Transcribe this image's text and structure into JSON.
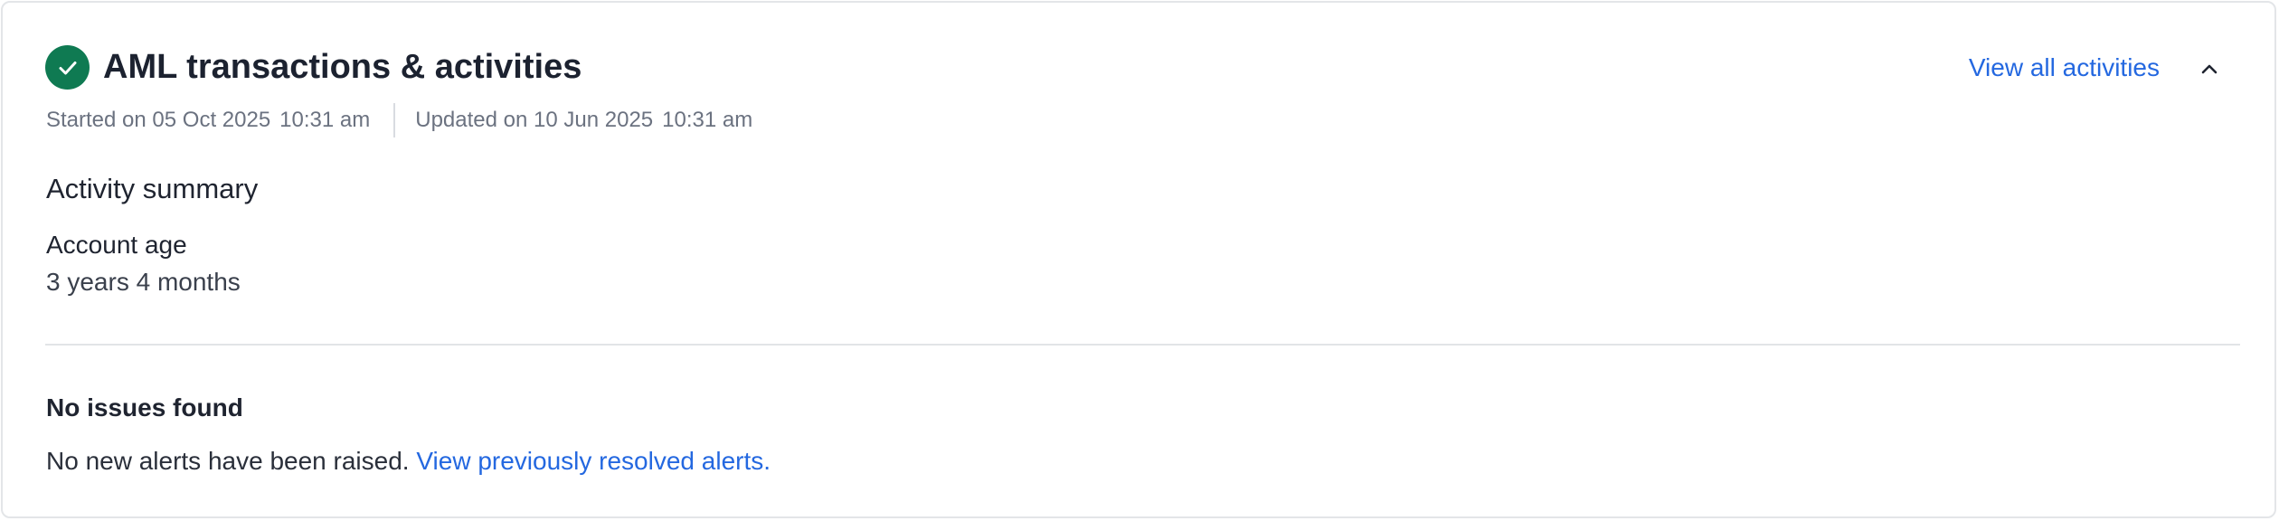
{
  "card": {
    "title": "AML transactions & activities",
    "status_icon": "check-circle-icon",
    "status_color": "#0f7a52",
    "view_all_label": "View all activities",
    "collapse_icon": "chevron-up-icon",
    "link_color": "#2468e0"
  },
  "meta": {
    "started_label": "Started on 05 Oct 2025",
    "started_time": "10:31 am",
    "updated_label": "Updated on 10 Jun 2025",
    "updated_time": "10:31 am"
  },
  "summary": {
    "heading": "Activity summary",
    "field_label": "Account age",
    "field_value": "3 years 4 months"
  },
  "issues": {
    "heading": "No issues found",
    "text": "No new alerts have been raised.",
    "link_label": "View previously resolved alerts."
  }
}
